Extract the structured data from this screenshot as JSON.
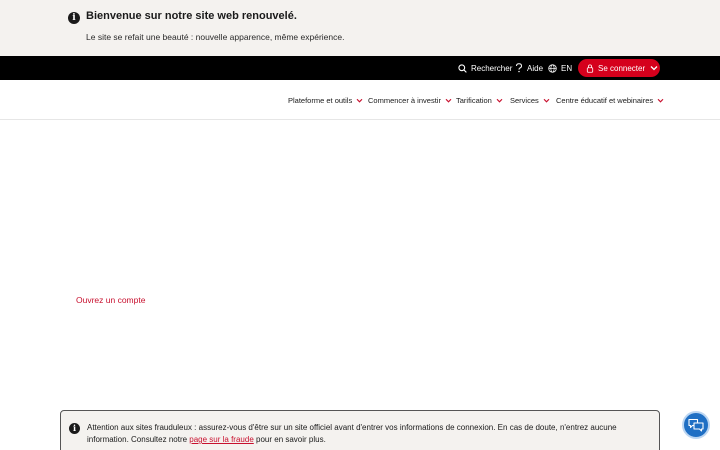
{
  "banner": {
    "title": "Bienvenue sur notre site web renouvelé.",
    "subtitle": "Le site se refait une beauté : nouvelle apparence, même expérience."
  },
  "topbar": {
    "search_label": "Rechercher",
    "help_label": "Aide",
    "language_label": "EN",
    "login_label": "Se connecter"
  },
  "nav": {
    "items": [
      {
        "label": "Plateforme et outils"
      },
      {
        "label": "Commencer à investir"
      },
      {
        "label": "Tarification"
      },
      {
        "label": "Services"
      },
      {
        "label": "Centre éducatif et webinaires"
      }
    ]
  },
  "main": {
    "open_account_label": "Ouvrez un compte"
  },
  "fraud_notice": {
    "text_before": "Attention aux sites frauduleux : assurez-vous d'être sur un site officiel avant d'entrer vos informations de connexion. En cas de doute, n'entrez aucune information. Consultez notre ",
    "link_label": "page sur la fraude",
    "text_after": " pour en savoir plus."
  },
  "colors": {
    "accent": "#d5001c",
    "banner_bg": "#f4f2ef",
    "topbar_bg": "#000000",
    "chat_bg": "#1f6fc4"
  },
  "icons": {
    "info": "info-icon",
    "search": "search-icon",
    "help": "question-icon",
    "language": "globe-icon",
    "login": "lock-icon",
    "chevron": "chevron-down-icon",
    "chat": "chat-bubbles-icon"
  }
}
